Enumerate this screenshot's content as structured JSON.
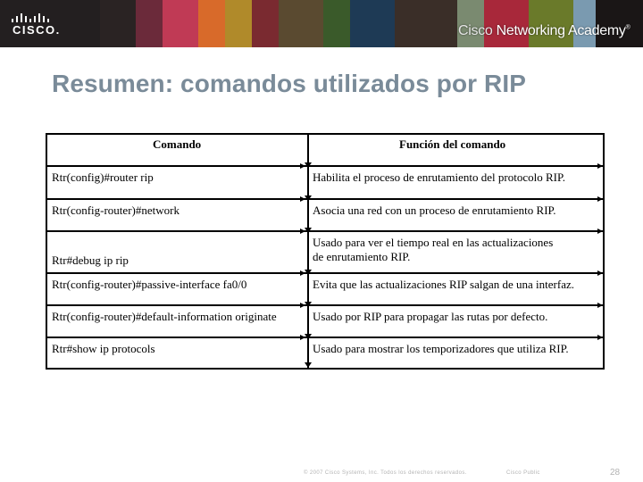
{
  "header": {
    "logo_text": "CISCO.",
    "academy_prefix": "Cisco",
    "academy_name": "Networking Academy",
    "academy_mark": "®"
  },
  "slide": {
    "title": "Resumen: comandos utilizados por RIP"
  },
  "table": {
    "columns": [
      "Comando",
      "Función del comando"
    ],
    "rows": [
      {
        "command": "Rtr(config)#router rip",
        "function": [
          "Habilita el proceso de enrutamiento del protocolo RIP."
        ]
      },
      {
        "command": "Rtr(config-router)#network",
        "function": [
          "Asocia una red con un proceso de enrutamiento RIP."
        ]
      },
      {
        "command": "Rtr#debug ip rip",
        "function": [
          "Usado para ver el tiempo real en las actualizaciones",
          "de enrutamiento RIP."
        ]
      },
      {
        "command": "Rtr(config-router)#passive-interface fa0/0",
        "function": [
          "Evita que las actualizaciones RIP salgan de una interfaz."
        ]
      },
      {
        "command": "Rtr(config-router)#default-information originate",
        "function": [
          "Usado por RIP para propagar las rutas por defecto."
        ]
      },
      {
        "command": "Rtr#show ip protocols",
        "function": [
          "Usado para mostrar los temporizadores que utiliza RIP."
        ]
      }
    ]
  },
  "footer": {
    "copyright": "© 2007 Cisco Systems, Inc. Todos los derechos reservados.",
    "classification": "Cisco Public",
    "page_number": "28"
  },
  "colors": {
    "title": "#7a8b99",
    "banner_dark": "#231f20"
  }
}
